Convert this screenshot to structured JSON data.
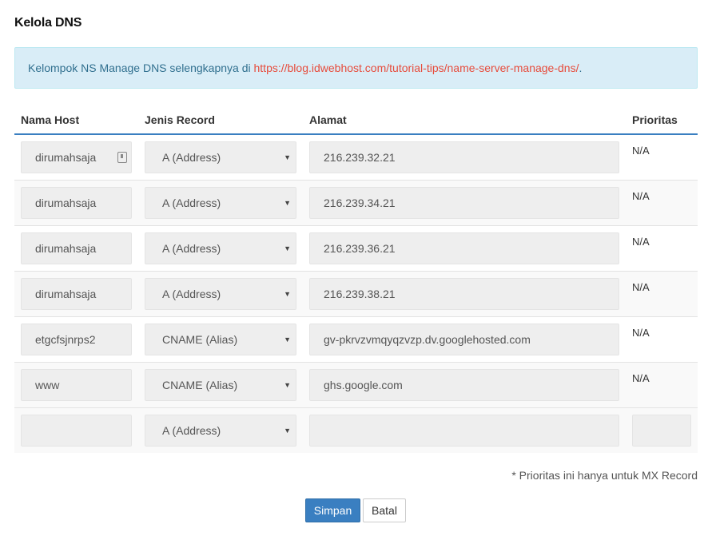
{
  "page": {
    "title": "Kelola DNS"
  },
  "info": {
    "text": "Kelompok NS Manage DNS selengkapnya di ",
    "link_text": "https://blog.idwebhost.com/tutorial-tips/name-server-manage-dns/",
    "suffix": "."
  },
  "table": {
    "headers": {
      "host": "Nama Host",
      "type": "Jenis Record",
      "address": "Alamat",
      "priority": "Prioritas"
    },
    "rows": [
      {
        "host": "dirumahsaja",
        "type": "A (Address)",
        "address": "216.239.32.21",
        "priority": "N/A"
      },
      {
        "host": "dirumahsaja",
        "type": "A (Address)",
        "address": "216.239.34.21",
        "priority": "N/A"
      },
      {
        "host": "dirumahsaja",
        "type": "A (Address)",
        "address": "216.239.36.21",
        "priority": "N/A"
      },
      {
        "host": "dirumahsaja",
        "type": "A (Address)",
        "address": "216.239.38.21",
        "priority": "N/A"
      },
      {
        "host": "etgcfsjnrps2",
        "type": "CNAME (Alias)",
        "address": "gv-pkrvzvmqyqzvzp.dv.googlehosted.com",
        "priority": "N/A"
      },
      {
        "host": "www",
        "type": "CNAME (Alias)",
        "address": "ghs.google.com",
        "priority": "N/A"
      }
    ],
    "new_row": {
      "host": "",
      "type": "A (Address)",
      "address": "",
      "priority": ""
    }
  },
  "note": "* Prioritas ini hanya untuk MX Record",
  "buttons": {
    "save": "Simpan",
    "cancel": "Batal"
  },
  "colors": {
    "primary": "#3a7fc1",
    "info_bg": "#d9edf7",
    "info_text": "#31708f",
    "link": "#e74c3c"
  }
}
